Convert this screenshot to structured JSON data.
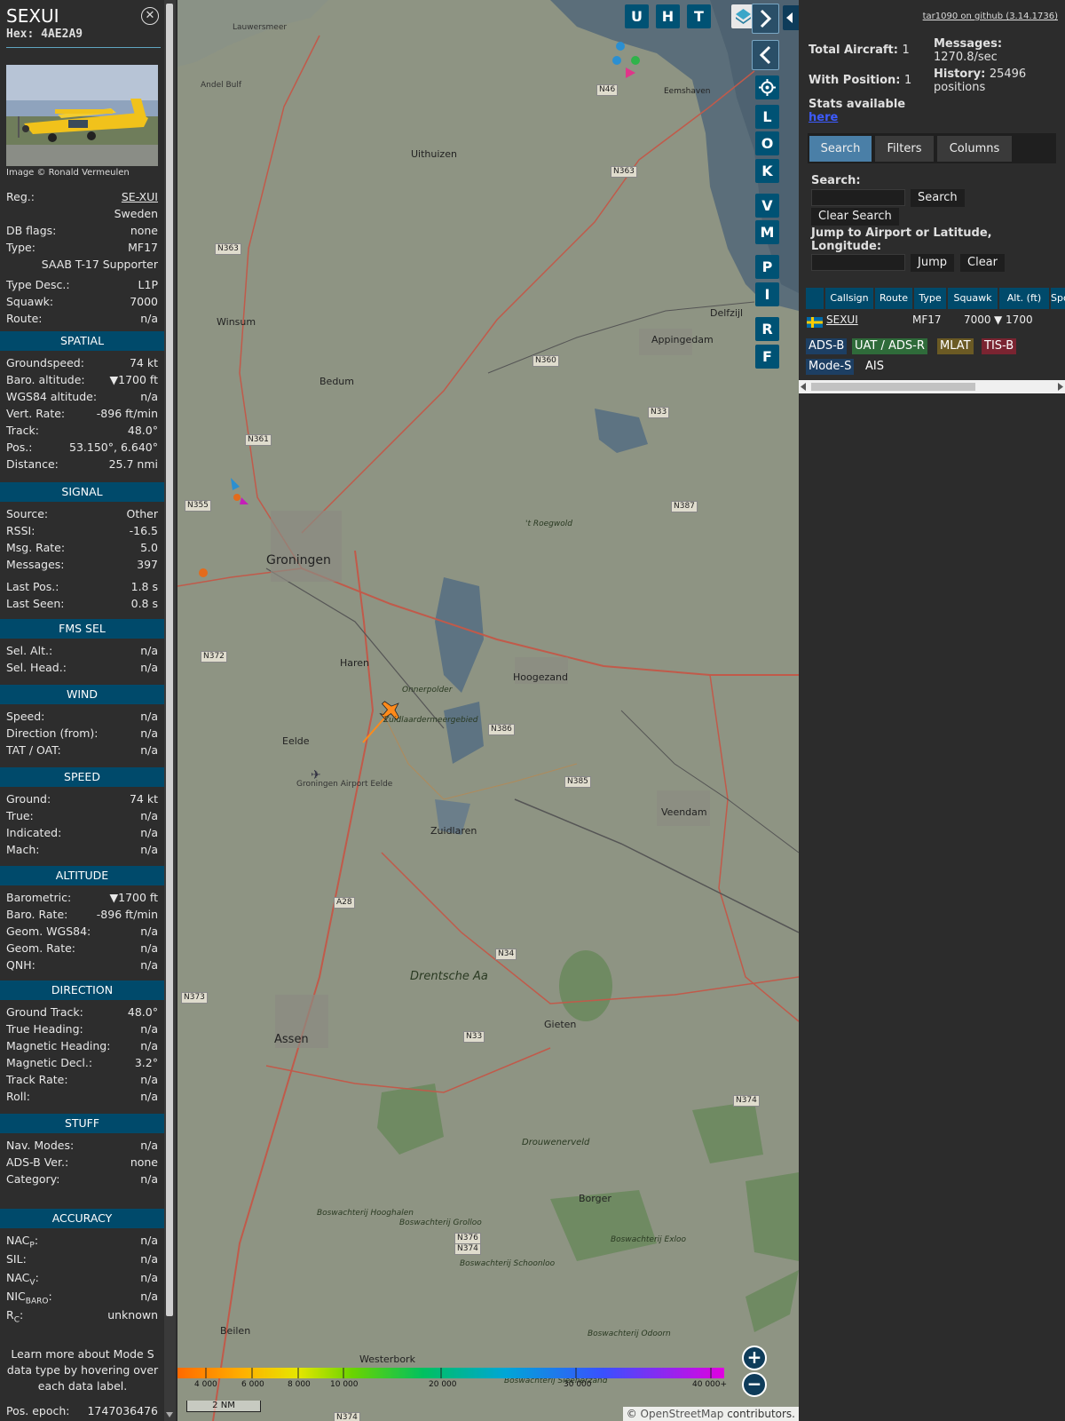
{
  "info": {
    "callsign": "SEXUI",
    "hex_label": "Hex:",
    "hex": "4AE2A9",
    "photo_credit": "Image © Ronald Vermeulen",
    "reg_label": "Reg.:",
    "reg": "SE-XUI",
    "country": "Sweden",
    "dbflags_label": "DB flags:",
    "dbflags": "none",
    "type_label": "Type:",
    "type": "MF17",
    "type_name": "SAAB T-17 Supporter",
    "typedesc_label": "Type Desc.:",
    "typedesc": "L1P",
    "squawk_label": "Squawk:",
    "squawk": "7000",
    "route_label": "Route:",
    "route": "n/a",
    "sections": {
      "spatial": "SPATIAL",
      "signal": "SIGNAL",
      "fms": "FMS SEL",
      "wind": "WIND",
      "speed": "SPEED",
      "altitude": "ALTITUDE",
      "direction": "DIRECTION",
      "stuff": "STUFF",
      "accuracy": "ACCURACY"
    },
    "spatial": [
      {
        "label": "Groundspeed:",
        "value": "74 kt"
      },
      {
        "label": "Baro. altitude:",
        "value": "▼1700 ft"
      },
      {
        "label": "WGS84 altitude:",
        "value": "n/a"
      },
      {
        "label": "Vert. Rate:",
        "value": "-896 ft/min"
      },
      {
        "label": "Track:",
        "value": "48.0°"
      },
      {
        "label": "Pos.:",
        "value": "53.150°, 6.640°"
      },
      {
        "label": "Distance:",
        "value": "25.7 nmi"
      }
    ],
    "signal": [
      {
        "label": "Source:",
        "value": "Other"
      },
      {
        "label": "RSSI:",
        "value": "-16.5"
      },
      {
        "label": "Msg. Rate:",
        "value": "5.0"
      },
      {
        "label": "Messages:",
        "value": "397"
      },
      {
        "label": "Last Pos.:",
        "value": "1.8 s"
      },
      {
        "label": "Last Seen:",
        "value": "0.8 s"
      }
    ],
    "fms": [
      {
        "label": "Sel. Alt.:",
        "value": "n/a"
      },
      {
        "label": "Sel. Head.:",
        "value": "n/a"
      }
    ],
    "wind": [
      {
        "label": "Speed:",
        "value": "n/a"
      },
      {
        "label": "Direction (from):",
        "value": "n/a"
      },
      {
        "label": "TAT / OAT:",
        "value": "n/a"
      }
    ],
    "speed": [
      {
        "label": "Ground:",
        "value": "74 kt"
      },
      {
        "label": "True:",
        "value": "n/a"
      },
      {
        "label": "Indicated:",
        "value": "n/a"
      },
      {
        "label": "Mach:",
        "value": "n/a"
      }
    ],
    "altitude": [
      {
        "label": "Barometric:",
        "value": "▼1700 ft"
      },
      {
        "label": "Baro. Rate:",
        "value": "-896 ft/min"
      },
      {
        "label": "Geom. WGS84:",
        "value": "n/a"
      },
      {
        "label": "Geom. Rate:",
        "value": "n/a"
      },
      {
        "label": "QNH:",
        "value": "n/a"
      }
    ],
    "direction": [
      {
        "label": "Ground Track:",
        "value": "48.0°"
      },
      {
        "label": "True Heading:",
        "value": "n/a"
      },
      {
        "label": "Magnetic Heading:",
        "value": "n/a"
      },
      {
        "label": "Magnetic Decl.:",
        "value": "3.2°"
      },
      {
        "label": "Track Rate:",
        "value": "n/a"
      },
      {
        "label": "Roll:",
        "value": "n/a"
      }
    ],
    "stuff": [
      {
        "label": "Nav. Modes:",
        "value": "n/a"
      },
      {
        "label": "ADS-B Ver.:",
        "value": "none"
      },
      {
        "label": "Category:",
        "value": "n/a"
      }
    ],
    "accuracy": [
      {
        "label": "NAC",
        "sub": "P",
        "value": "n/a"
      },
      {
        "label": "SIL:",
        "sub": "",
        "value": "n/a"
      },
      {
        "label": "NAC",
        "sub": "V",
        "value": "n/a"
      },
      {
        "label": "NIC",
        "sub": "BARO",
        "value": "n/a"
      },
      {
        "label": "R",
        "sub": "C",
        "value": "unknown"
      }
    ],
    "learn_more": "Learn more about Mode S data type by hovering over each data label.",
    "pos_epoch_label": "Pos. epoch:",
    "pos_epoch": "1747036476"
  },
  "map": {
    "buttons_top": [
      "U",
      "H",
      "T"
    ],
    "buttons_side": [
      "L",
      "O",
      "K",
      "V",
      "M",
      "P",
      "I",
      "R",
      "F"
    ],
    "places": [
      {
        "name": "Groningen"
      },
      {
        "name": "Uithuizen"
      },
      {
        "name": "Winsum"
      },
      {
        "name": "Bedum"
      },
      {
        "name": "Appingedam"
      },
      {
        "name": "Delfzijl"
      },
      {
        "name": "Hoogezand"
      },
      {
        "name": "Haren"
      },
      {
        "name": "Eelde"
      },
      {
        "name": "Zuidlaren"
      },
      {
        "name": "Veendam"
      },
      {
        "name": "Drentsche Aa"
      },
      {
        "name": "Assen"
      },
      {
        "name": "Gieten"
      },
      {
        "name": "Borger"
      },
      {
        "name": "Beilen"
      },
      {
        "name": "Westerbork"
      },
      {
        "name": "Eemshaven"
      },
      {
        "name": "Groningen Airport Eelde"
      },
      {
        "name": "'t Roegwold"
      },
      {
        "name": "Onnerpolder"
      },
      {
        "name": "Zuidlaardermeergebied"
      },
      {
        "name": "Drouwenerveld"
      },
      {
        "name": "Boswachterij Hooghalen"
      },
      {
        "name": "Boswachterij Grolloo"
      },
      {
        "name": "Boswachterij Schoonloo"
      },
      {
        "name": "Boswachterij Exloo"
      },
      {
        "name": "Boswachterij Odoorn"
      },
      {
        "name": "Boswachterij Sleenerzand"
      },
      {
        "name": "Lauwersmeer"
      },
      {
        "name": "Andel Bulf"
      }
    ],
    "road_labels": [
      "N46",
      "N363",
      "N363",
      "N360",
      "N33",
      "N361",
      "N355",
      "N387",
      "N372",
      "N386",
      "N385",
      "N34",
      "N33",
      "N373",
      "N374",
      "N376",
      "N374",
      "A28",
      "N374"
    ],
    "altitude_scale": [
      "4 000",
      "6 000",
      "8 000",
      "10 000",
      "20 000",
      "30 000",
      "40 000+"
    ],
    "scale_bar": "2 NM",
    "attribution_prefix": "© ",
    "attribution_link": "OpenStreetMap",
    "attribution_suffix": " contributors.",
    "zoom_in": "+",
    "zoom_out": "−"
  },
  "right": {
    "github": "tar1090 on github (3.14.1736)",
    "total_aircraft_label": "Total Aircraft:",
    "total_aircraft": "1",
    "with_position_label": "With Position:",
    "with_position": "1",
    "stats_label": "Stats available",
    "stats_link": "here",
    "messages_label": "Messages:",
    "messages": "1270.8/sec",
    "history_label": "History:",
    "history": "25496 positions",
    "tabs": [
      "Search",
      "Filters",
      "Columns"
    ],
    "search_label": "Search:",
    "search_button": "Search",
    "clear_search_button": "Clear Search",
    "jump_label": "Jump to Airport or Latitude, Longitude:",
    "jump_button": "Jump",
    "clear_button": "Clear",
    "table_headers": [
      "Callsign",
      "Route",
      "Type",
      "Squawk",
      "Alt. (ft)",
      "Spd"
    ],
    "table_row": {
      "callsign": "SEXUI",
      "route": "",
      "type": "MF17",
      "squawk": "7000",
      "alt": "▼ 1700"
    },
    "legend": [
      {
        "label": "ADS-B",
        "color": "#1d3f63"
      },
      {
        "label": "UAT / ADS-R",
        "color": "#2f6b3a"
      },
      {
        "label": "MLAT",
        "color": "#6b5a24"
      },
      {
        "label": "TIS-B",
        "color": "#7a2431"
      },
      {
        "label": "Mode-S",
        "color": "#1d3f63"
      },
      {
        "label": "AIS",
        "color": "#2c2c2c"
      }
    ]
  }
}
